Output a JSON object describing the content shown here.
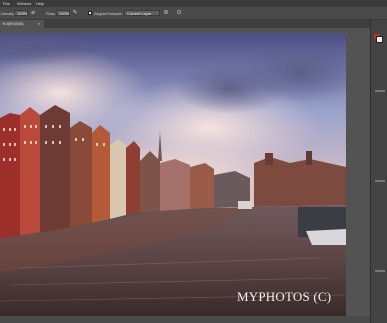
{
  "menubar": {
    "items": [
      "Fbe",
      "Window",
      "Help"
    ]
  },
  "options": {
    "density_label": "Density:",
    "density_value": "100%",
    "flow_label": "Flow:",
    "flow_value": "100%",
    "aligned_label": "Aligned",
    "sample_label": "Sample:",
    "sample_value": "Current Layer"
  },
  "document": {
    "tab_title": "% 8(RGB/8)",
    "close": "×"
  },
  "image": {
    "watermark": "MYPHOTOS (C)"
  },
  "icons": {
    "airbrush": "airbrush-icon",
    "flow": "flow-icon",
    "clone_source": "clone-source-icon",
    "ignore_adjust": "ignore-adjustment-icon",
    "foreground_color": "foreground-swatch",
    "background_color": "background-swatch"
  },
  "colors": {
    "ui_dark": "#535353",
    "panel": "#444444",
    "foreground": "#f0f0f0",
    "background": "#c8262a"
  }
}
